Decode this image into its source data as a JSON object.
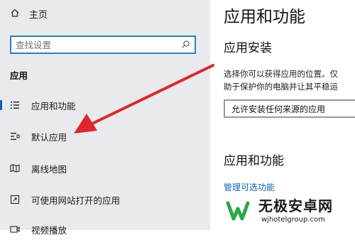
{
  "sidebar": {
    "home_label": "主页",
    "search_placeholder": "查找设置",
    "section_title": "应用",
    "items": [
      {
        "label": "应用和功能",
        "icon": "list-icon",
        "active": true
      },
      {
        "label": "默认应用",
        "icon": "default-apps-icon"
      },
      {
        "label": "离线地图",
        "icon": "map-icon"
      },
      {
        "label": "可使用网站打开的应用",
        "icon": "website-apps-icon"
      },
      {
        "label": "视频播放",
        "icon": "video-icon"
      }
    ]
  },
  "main": {
    "title": "应用和功能",
    "install_heading": "应用安装",
    "install_desc_line1": "选择你可以获得应用的位置。仅",
    "install_desc_line2": "助于保护你的电脑并让其平稳运",
    "install_dropdown_value": "允许安装任何来源的应用",
    "features_heading": "应用和功能",
    "manage_link": "管理可选功能"
  },
  "watermark": {
    "text": "无极安卓网",
    "url": "wjhotelgroup.com"
  },
  "colors": {
    "sidebar_bg": "#e9eaee",
    "accent": "#0b63b6",
    "arrow": "#e0262a"
  }
}
